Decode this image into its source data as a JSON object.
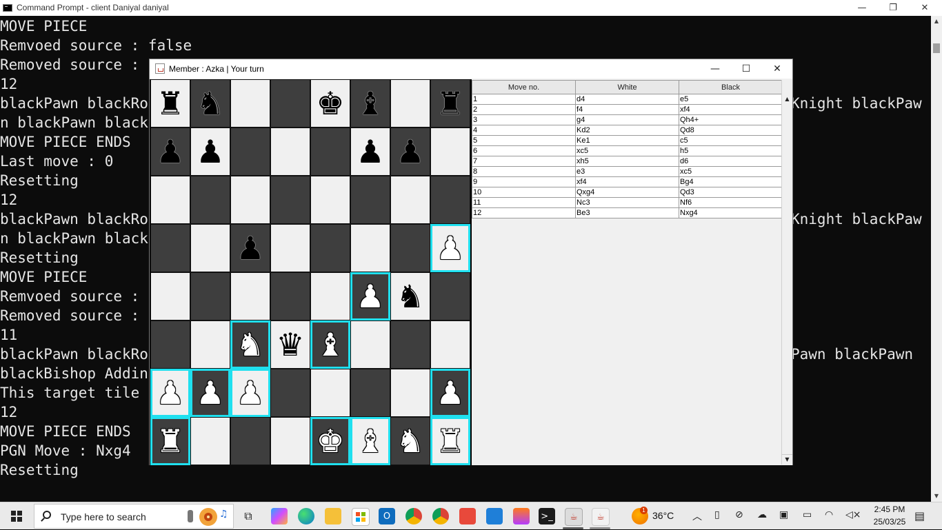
{
  "console": {
    "title": "Command Prompt - client  Daniyal daniyal",
    "minimize": "—",
    "restore": "❐",
    "close": "✕",
    "lines": [
      "MOVE PIECE",
      "Remvoed source : false",
      "Removed source : ",
      "12",
      "blackPawn blackRo",
      "n blackPawn black",
      "MOVE PIECE ENDS",
      "Last move : 0",
      "Resetting",
      "12",
      "blackPawn blackRo",
      "n blackPawn black",
      "Resetting",
      "MOVE PIECE",
      "Remvoed source : ",
      "Removed source : ",
      "11",
      "blackPawn blackRo",
      "blackBishop Addin",
      "This target tile",
      "12",
      "MOVE PIECE ENDS",
      "PGN Move : Nxg4",
      "Resetting"
    ],
    "right_fragments": [
      {
        "line": 4,
        "text": "Knight blackPaw"
      },
      {
        "line": 10,
        "text": "Knight blackPaw"
      },
      {
        "line": 17,
        "text": "Pawn blackPawn"
      }
    ]
  },
  "chess": {
    "title": "Member : Azka | Your turn",
    "minimize": "—",
    "maximize": "☐",
    "close": "✕",
    "board": [
      [
        {
          "p": "♜",
          "c": "black",
          "hl": false
        },
        {
          "p": "♞",
          "c": "black",
          "hl": false
        },
        {
          "p": "",
          "c": "",
          "hl": false
        },
        {
          "p": "",
          "c": "",
          "hl": false
        },
        {
          "p": "♚",
          "c": "black",
          "hl": false
        },
        {
          "p": "♝",
          "c": "black",
          "hl": false
        },
        {
          "p": "",
          "c": "",
          "hl": false
        },
        {
          "p": "♜",
          "c": "black",
          "hl": false
        }
      ],
      [
        {
          "p": "♟",
          "c": "black",
          "hl": false
        },
        {
          "p": "♟",
          "c": "black",
          "hl": false
        },
        {
          "p": "",
          "c": "",
          "hl": false
        },
        {
          "p": "",
          "c": "",
          "hl": false
        },
        {
          "p": "",
          "c": "",
          "hl": false
        },
        {
          "p": "♟",
          "c": "black",
          "hl": false
        },
        {
          "p": "♟",
          "c": "black",
          "hl": false
        },
        {
          "p": "",
          "c": "",
          "hl": false
        }
      ],
      [
        {
          "p": "",
          "c": "",
          "hl": false
        },
        {
          "p": "",
          "c": "",
          "hl": false
        },
        {
          "p": "",
          "c": "",
          "hl": false
        },
        {
          "p": "",
          "c": "",
          "hl": false
        },
        {
          "p": "",
          "c": "",
          "hl": false
        },
        {
          "p": "",
          "c": "",
          "hl": false
        },
        {
          "p": "",
          "c": "",
          "hl": false
        },
        {
          "p": "",
          "c": "",
          "hl": false
        }
      ],
      [
        {
          "p": "",
          "c": "",
          "hl": false
        },
        {
          "p": "",
          "c": "",
          "hl": false
        },
        {
          "p": "♟",
          "c": "black",
          "hl": false
        },
        {
          "p": "",
          "c": "",
          "hl": false
        },
        {
          "p": "",
          "c": "",
          "hl": false
        },
        {
          "p": "",
          "c": "",
          "hl": false
        },
        {
          "p": "",
          "c": "",
          "hl": false
        },
        {
          "p": "♟",
          "c": "white",
          "hl": true
        }
      ],
      [
        {
          "p": "",
          "c": "",
          "hl": false
        },
        {
          "p": "",
          "c": "",
          "hl": false
        },
        {
          "p": "",
          "c": "",
          "hl": false
        },
        {
          "p": "",
          "c": "",
          "hl": false
        },
        {
          "p": "",
          "c": "",
          "hl": false
        },
        {
          "p": "♟",
          "c": "white",
          "hl": true
        },
        {
          "p": "♞",
          "c": "black",
          "hl": false
        },
        {
          "p": "",
          "c": "",
          "hl": false
        }
      ],
      [
        {
          "p": "",
          "c": "",
          "hl": false
        },
        {
          "p": "",
          "c": "",
          "hl": false
        },
        {
          "p": "♞",
          "c": "white",
          "hl": true
        },
        {
          "p": "♛",
          "c": "black",
          "hl": false
        },
        {
          "p": "♝",
          "c": "white",
          "hl": true
        },
        {
          "p": "",
          "c": "",
          "hl": false
        },
        {
          "p": "",
          "c": "",
          "hl": false
        },
        {
          "p": "",
          "c": "",
          "hl": false
        }
      ],
      [
        {
          "p": "♟",
          "c": "white",
          "hl": true
        },
        {
          "p": "♟",
          "c": "white",
          "hl": true
        },
        {
          "p": "♟",
          "c": "white",
          "hl": true
        },
        {
          "p": "",
          "c": "",
          "hl": false
        },
        {
          "p": "",
          "c": "",
          "hl": false
        },
        {
          "p": "",
          "c": "",
          "hl": false
        },
        {
          "p": "",
          "c": "",
          "hl": false
        },
        {
          "p": "♟",
          "c": "white",
          "hl": true
        }
      ],
      [
        {
          "p": "♜",
          "c": "white",
          "hl": true
        },
        {
          "p": "",
          "c": "",
          "hl": false
        },
        {
          "p": "",
          "c": "",
          "hl": false
        },
        {
          "p": "",
          "c": "",
          "hl": false
        },
        {
          "p": "♚",
          "c": "white",
          "hl": true
        },
        {
          "p": "♝",
          "c": "white",
          "hl": true
        },
        {
          "p": "♞",
          "c": "white",
          "hl": false
        },
        {
          "p": "♜",
          "c": "white",
          "hl": true
        }
      ]
    ],
    "square_colors": {
      "light": "#f0f0f0",
      "dark": "#3e3e3e",
      "highlight": "#1fe0ef"
    },
    "table": {
      "headers": [
        "Move no.",
        "White",
        "Black"
      ],
      "rows": [
        [
          "1",
          "d4",
          "e5"
        ],
        [
          "2",
          "f4",
          "xf4"
        ],
        [
          "3",
          "g4",
          "Qh4+"
        ],
        [
          "4",
          "Kd2",
          "Qd8"
        ],
        [
          "5",
          "Ke1",
          "c5"
        ],
        [
          "6",
          "xc5",
          "h5"
        ],
        [
          "7",
          "xh5",
          "d6"
        ],
        [
          "8",
          "e3",
          "xc5"
        ],
        [
          "9",
          "xf4",
          "Bg4"
        ],
        [
          "10",
          "Qxg4",
          "Qd3"
        ],
        [
          "11",
          "Nc3",
          "Nf6"
        ],
        [
          "12",
          "Be3",
          "Nxg4"
        ]
      ]
    }
  },
  "taskbar": {
    "search_placeholder": "Type here to search",
    "weather": "36°C",
    "time": "2:45 PM",
    "date": "25/03/25",
    "weather_badge": "1",
    "apps": [
      "task-view",
      "copilot",
      "edge",
      "file-explorer",
      "store",
      "outlook",
      "chrome-profile-d",
      "chrome",
      "app-red",
      "photos",
      "paint",
      "terminal",
      "java-chess-1",
      "java-chess-2"
    ]
  }
}
